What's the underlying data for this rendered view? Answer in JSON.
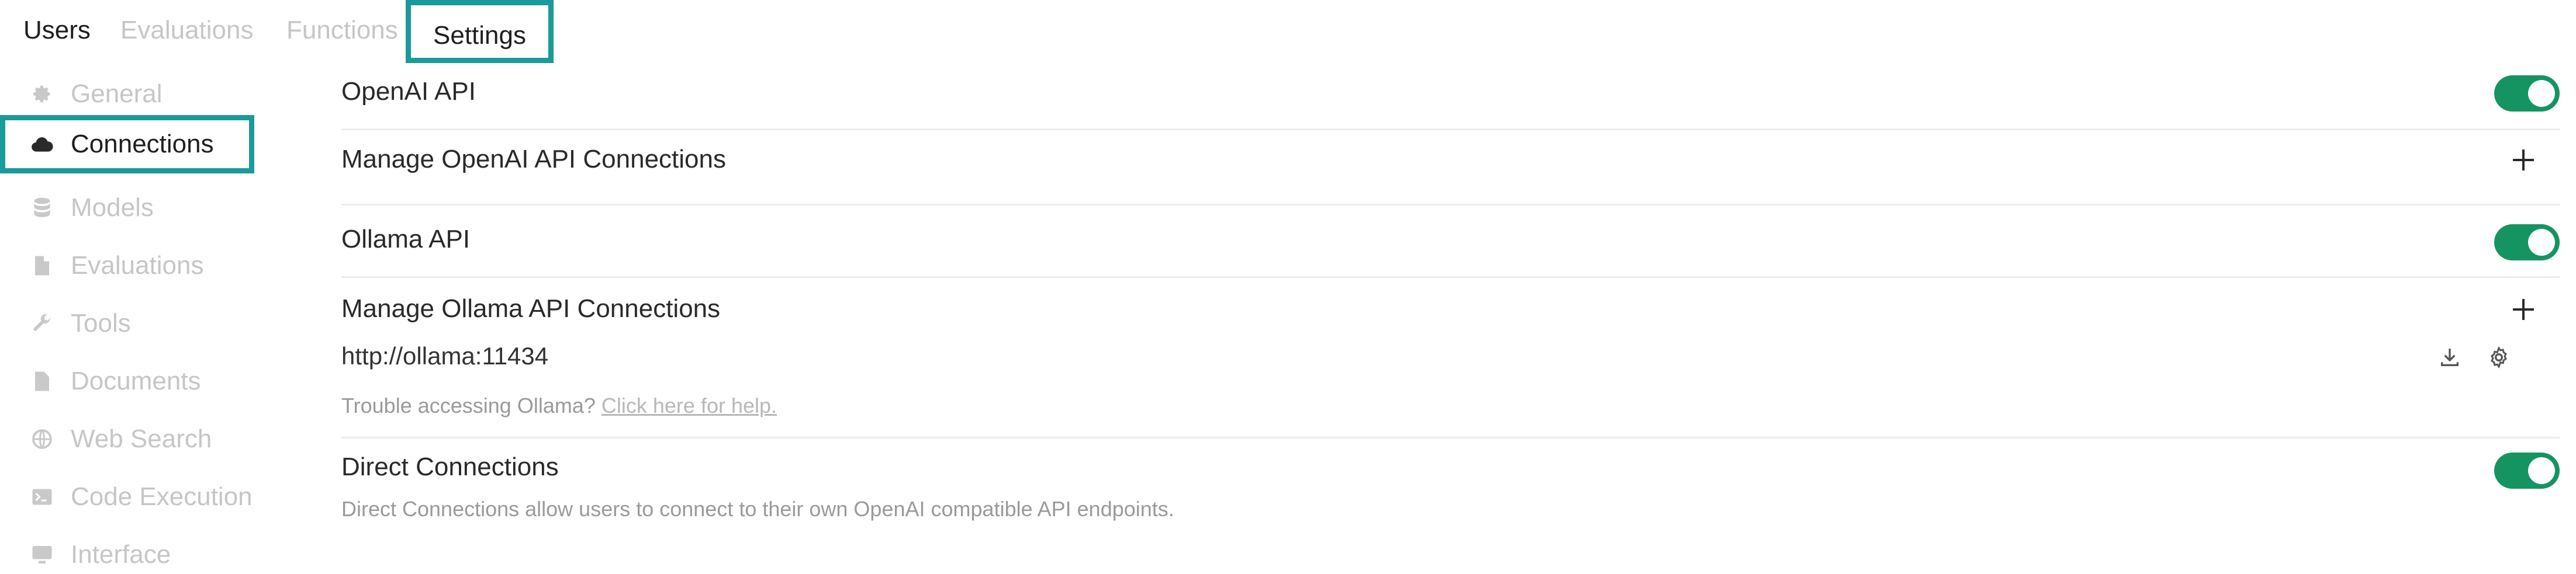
{
  "tabs": [
    {
      "label": "Users"
    },
    {
      "label": "Evaluations"
    },
    {
      "label": "Functions"
    },
    {
      "label": "Settings"
    }
  ],
  "sidebar": {
    "items": [
      {
        "label": "General",
        "icon": "gear-icon"
      },
      {
        "label": "Connections",
        "icon": "cloud-icon"
      },
      {
        "label": "Models",
        "icon": "database-icon"
      },
      {
        "label": "Evaluations",
        "icon": "document-icon"
      },
      {
        "label": "Tools",
        "icon": "wrench-icon"
      },
      {
        "label": "Documents",
        "icon": "document-icon"
      },
      {
        "label": "Web Search",
        "icon": "globe-icon"
      },
      {
        "label": "Code Execution",
        "icon": "terminal-icon"
      },
      {
        "label": "Interface",
        "icon": "monitor-icon"
      }
    ],
    "selected": "Connections"
  },
  "main": {
    "openai": {
      "title": "OpenAI API",
      "enabled": true,
      "manage_label": "Manage OpenAI API Connections"
    },
    "ollama": {
      "title": "Ollama API",
      "enabled": true,
      "manage_label": "Manage Ollama API Connections",
      "url": "http://ollama:11434",
      "help_prefix": "Trouble accessing Ollama?",
      "help_link": "Click here for help."
    },
    "direct": {
      "title": "Direct Connections",
      "enabled": true,
      "description": "Direct Connections allow users to connect to their own OpenAI compatible API endpoints."
    }
  },
  "colors": {
    "accent_outline": "#1a9a9a",
    "toggle_on": "#159461",
    "muted_text": "#c6c6c6"
  }
}
